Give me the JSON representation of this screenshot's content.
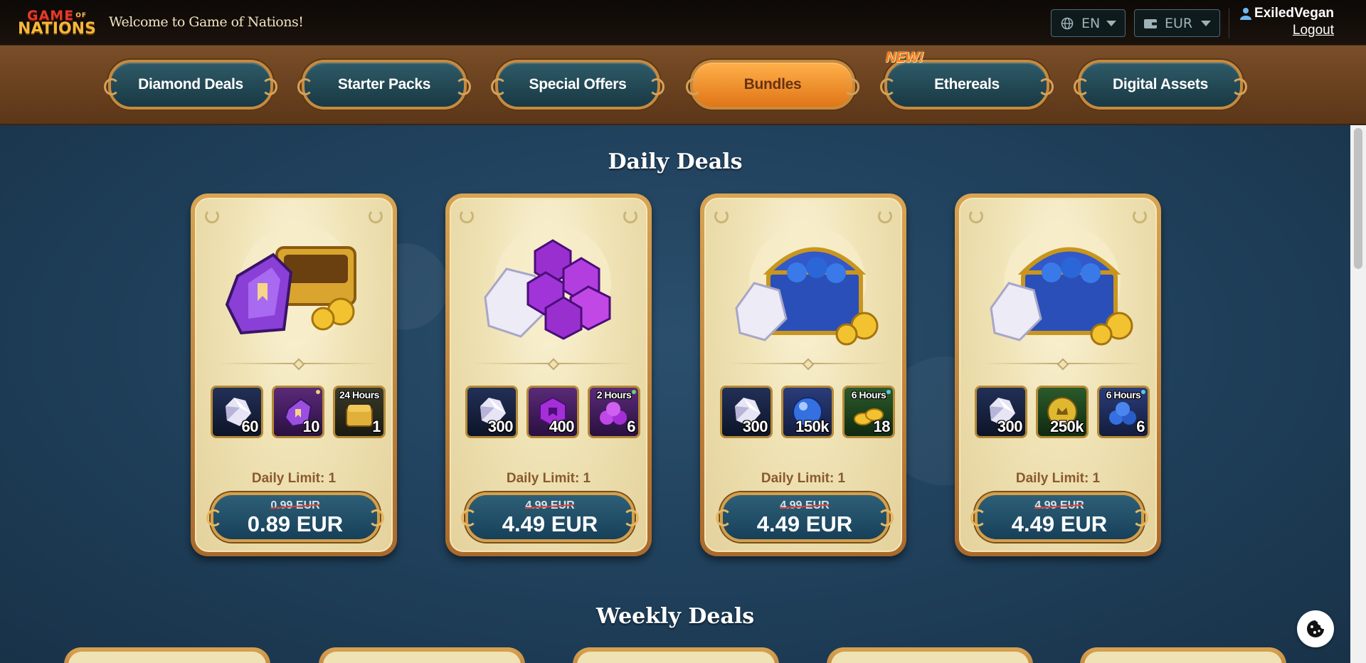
{
  "header": {
    "logo_line1": "GAME",
    "logo_of": "OF",
    "logo_line2": "NATIONS",
    "welcome": "Welcome to Game of Nations!",
    "language": "EN",
    "currency": "EUR",
    "username": "ExiledVegan",
    "logout": "Logout"
  },
  "tabs": [
    {
      "label": "Diamond Deals",
      "active": false
    },
    {
      "label": "Starter Packs",
      "active": false
    },
    {
      "label": "Special Offers",
      "active": false
    },
    {
      "label": "Bundles",
      "active": true
    },
    {
      "label": "Ethereals",
      "active": false,
      "badge": "NEW!"
    },
    {
      "label": "Digital Assets",
      "active": false
    }
  ],
  "sections": {
    "daily_title": "Daily Deals",
    "weekly_title": "Weekly Deals"
  },
  "deals": [
    {
      "art": "purple-crystal-and-gold-chest",
      "items": [
        {
          "icon": "diamond-icon",
          "qty": "60",
          "duration": ""
        },
        {
          "icon": "purple-crystal-icon",
          "qty": "10",
          "duration": ""
        },
        {
          "icon": "gold-chest-icon",
          "qty": "1",
          "duration": "24 Hours"
        }
      ],
      "limit": "Daily Limit: 1",
      "old_price": "0.99 EUR",
      "price": "0.89 EUR"
    },
    {
      "art": "diamond-and-purple-gems",
      "items": [
        {
          "icon": "diamond-icon",
          "qty": "300",
          "duration": ""
        },
        {
          "icon": "purple-gem-icon",
          "qty": "400",
          "duration": ""
        },
        {
          "icon": "purple-gems-pile-icon",
          "qty": "6",
          "duration": "2 Hours"
        }
      ],
      "limit": "Daily Limit: 1",
      "old_price": "4.99 EUR",
      "price": "4.49 EUR"
    },
    {
      "art": "blue-chest-with-orbs",
      "items": [
        {
          "icon": "diamond-icon",
          "qty": "300",
          "duration": ""
        },
        {
          "icon": "blue-orb-icon",
          "qty": "150k",
          "duration": ""
        },
        {
          "icon": "gold-coins-icon",
          "qty": "18",
          "duration": "6 Hours"
        }
      ],
      "limit": "Daily Limit: 1",
      "old_price": "4.99 EUR",
      "price": "4.49 EUR"
    },
    {
      "art": "blue-chest-with-orbs",
      "items": [
        {
          "icon": "diamond-icon",
          "qty": "300",
          "duration": ""
        },
        {
          "icon": "gold-coin-icon",
          "qty": "250k",
          "duration": ""
        },
        {
          "icon": "blue-orbs-pile-icon",
          "qty": "6",
          "duration": "6 Hours"
        }
      ],
      "limit": "Daily Limit: 1",
      "old_price": "4.99 EUR",
      "price": "4.49 EUR"
    }
  ],
  "colors": {
    "accent_orange": "#f39a2e",
    "tab_teal": "#1f4452",
    "frame_gold": "#c68a3f",
    "parchment": "#efe2b4"
  }
}
